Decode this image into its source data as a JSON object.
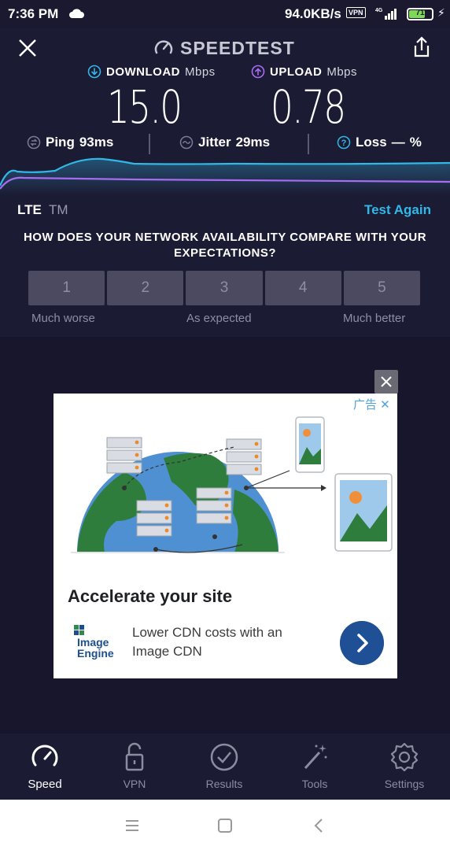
{
  "status_bar": {
    "time": "7:36 PM",
    "net_speed": "94.0KB/s",
    "vpn_badge": "VPN",
    "network": "4G",
    "battery_level": 71,
    "battery_text": "71"
  },
  "header": {
    "title": "SPEEDTEST",
    "icons": [
      "close-icon",
      "speedometer-icon",
      "share-icon"
    ]
  },
  "results": {
    "download": {
      "label": "DOWNLOAD",
      "unit": "Mbps",
      "value": "15.0"
    },
    "upload": {
      "label": "UPLOAD",
      "unit": "Mbps",
      "value": "0.78"
    },
    "ping": {
      "label": "Ping",
      "value": "93ms"
    },
    "jitter": {
      "label": "Jitter",
      "value": "29ms"
    },
    "loss": {
      "label": "Loss",
      "value": "—",
      "unit": "%"
    }
  },
  "connection": {
    "type": "LTE",
    "carrier": "TM",
    "test_again": "Test Again"
  },
  "survey": {
    "question": "HOW DOES YOUR NETWORK AVAILABILITY COMPARE WITH YOUR EXPECTATIONS?",
    "options": [
      "1",
      "2",
      "3",
      "4",
      "5"
    ],
    "low_label": "Much worse",
    "mid_label": "As expected",
    "high_label": "Much better"
  },
  "ad": {
    "tag": "广告",
    "headline": "Accelerate your site",
    "logo_text": "Image Engine",
    "body": "Lower CDN costs with an Image CDN"
  },
  "tabs": [
    {
      "label": "Speed",
      "icon": "speedometer-icon",
      "active": true
    },
    {
      "label": "VPN",
      "icon": "lock-icon",
      "active": false
    },
    {
      "label": "Results",
      "icon": "checkmark-icon",
      "active": false
    },
    {
      "label": "Tools",
      "icon": "magic-wand-icon",
      "active": false
    },
    {
      "label": "Settings",
      "icon": "gear-icon",
      "active": false
    }
  ],
  "colors": {
    "background": "#1c1b34",
    "accent_cyan": "#31b8e6",
    "accent_purple": "#a66cf2",
    "ad_cta": "#1f4f94"
  }
}
